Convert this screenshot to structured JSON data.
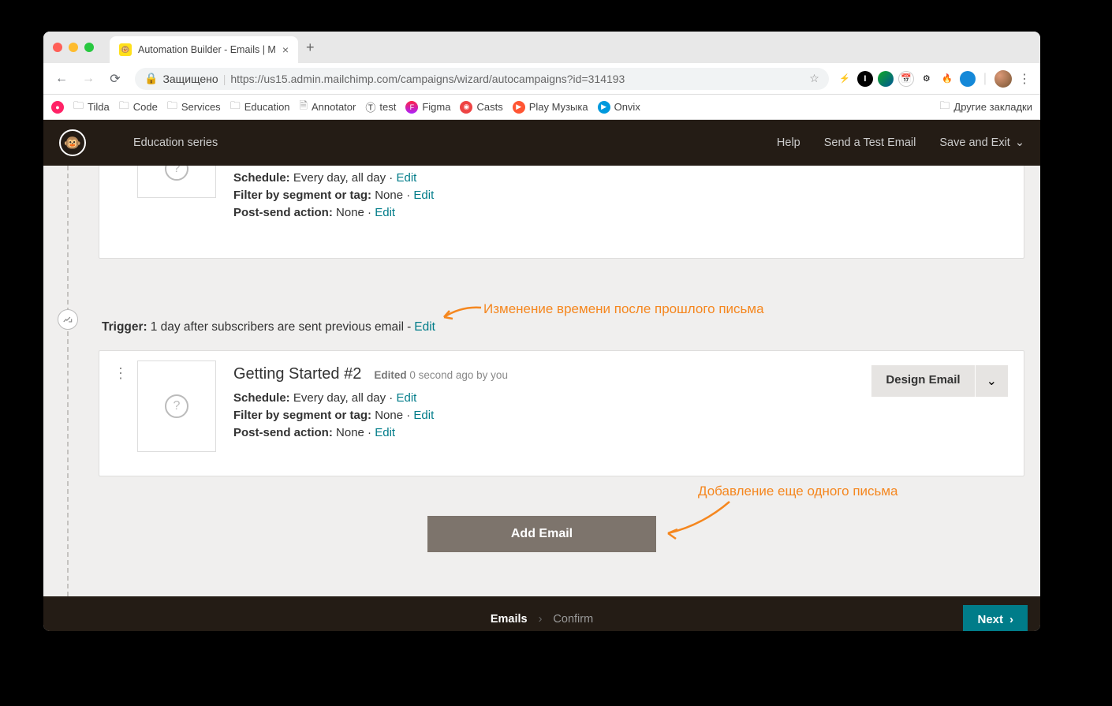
{
  "browser": {
    "tab_title": "Automation Builder - Emails | M",
    "url_proto": "https://",
    "url_domain": "us15.admin.mailchimp.com",
    "url_path": "/campaigns/wizard/autocampaigns?id=314193",
    "secure_label": "Защищено",
    "bookmarks": [
      "Tilda",
      "Code",
      "Services",
      "Education",
      "Annotator",
      "test",
      "Figma",
      "Casts",
      "Play Музыка",
      "Onvix"
    ],
    "other_bookmarks": "Другие закладки"
  },
  "header": {
    "campaign_name": "Education series",
    "help": "Help",
    "send_test": "Send a Test Email",
    "save_exit": "Save and Exit"
  },
  "card1": {
    "schedule_label": "Schedule:",
    "schedule_value": "Every day, all day",
    "filter_label": "Filter by segment or tag:",
    "filter_value": "None",
    "post_label": "Post-send action:",
    "post_value": "None",
    "edit": "Edit"
  },
  "trigger": {
    "label": "Trigger:",
    "text": "1 day after subscribers are sent previous email",
    "edit": "Edit"
  },
  "card2": {
    "title": "Getting Started #2",
    "meta_prefix": "Edited",
    "meta_value": "0 second ago by you",
    "schedule_label": "Schedule:",
    "schedule_value": "Every day, all day",
    "filter_label": "Filter by segment or tag:",
    "filter_value": "None",
    "post_label": "Post-send action:",
    "post_value": "None",
    "edit": "Edit",
    "design_btn": "Design Email"
  },
  "add_email_label": "Add Email",
  "annotations": {
    "trigger_note": "Изменение времени после прошлого письма",
    "add_note": "Добавление еще одного письма"
  },
  "footer": {
    "step1": "Emails",
    "step2": "Confirm",
    "next": "Next"
  }
}
